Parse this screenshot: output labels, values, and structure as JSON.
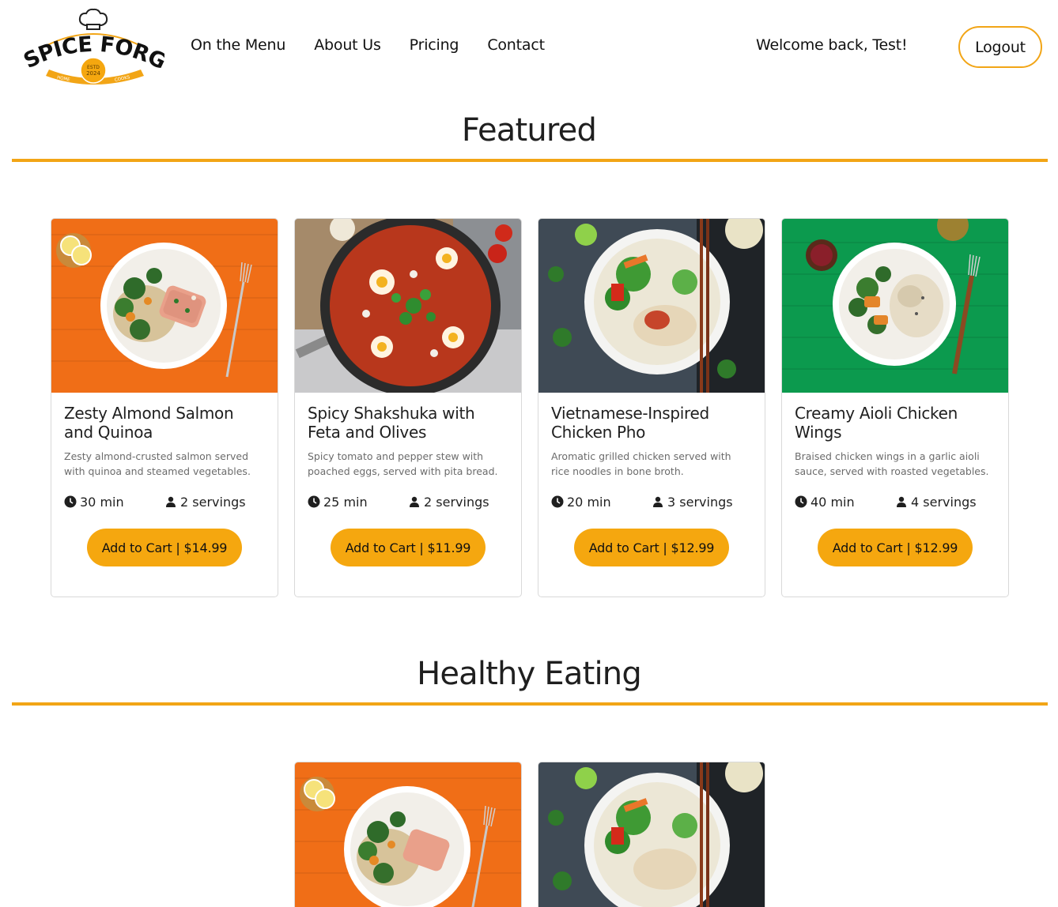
{
  "header": {
    "logo": {
      "brand": "SPICE FORGE",
      "estd": "ESTD",
      "year": "2024",
      "left_tag": "HOME",
      "right_tag": "COOKS"
    },
    "nav": [
      "On the Menu",
      "About Us",
      "Pricing",
      "Contact"
    ],
    "welcome": "Welcome back, Test!",
    "logout_label": "Logout"
  },
  "colors": {
    "accent": "#f2a516",
    "button": "#f5a70f"
  },
  "sections": [
    {
      "title": "Featured",
      "cards": [
        {
          "title": "Zesty Almond Salmon and Quinoa",
          "description": "Zesty almond-crusted salmon served with quinoa and steamed vegetables.",
          "time": "30 min",
          "servings": "2 servings",
          "button": "Add to Cart | $14.99",
          "image": "salmon-orange"
        },
        {
          "title": "Spicy Shakshuka with Feta and Olives",
          "description": "Spicy tomato and pepper stew with poached eggs, served with pita bread.",
          "time": "25 min",
          "servings": "2 servings",
          "button": "Add to Cart | $11.99",
          "image": "shakshuka-pan"
        },
        {
          "title": "Vietnamese-Inspired Chicken Pho",
          "description": "Aromatic grilled chicken served with rice noodles in bone broth.",
          "time": "20 min",
          "servings": "3 servings",
          "button": "Add to Cart | $12.99",
          "image": "pho-bowl"
        },
        {
          "title": "Creamy Aioli Chicken Wings",
          "description": "Braised chicken wings in a garlic aioli sauce, served with roasted vegetables.",
          "time": "40 min",
          "servings": "4 servings",
          "button": "Add to Cart | $12.99",
          "image": "chicken-green"
        }
      ]
    },
    {
      "title": "Healthy Eating",
      "cards": [
        {
          "image": "salmon-orange"
        },
        {
          "image": "pho-bowl"
        }
      ]
    }
  ]
}
